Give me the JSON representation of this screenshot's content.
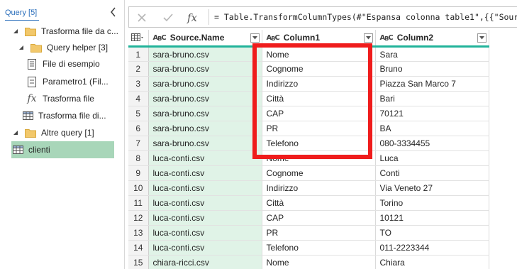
{
  "queries_pane": {
    "title": "Query [5]",
    "items": [
      {
        "label": "Trasforma file da c...",
        "icon": "folder-icon",
        "arrow": "expanded"
      },
      {
        "label": "Query helper [3]",
        "icon": "folder-icon",
        "arrow": "expanded"
      },
      {
        "label": "File di esempio",
        "icon": "document-icon",
        "arrow": ""
      },
      {
        "label": "Parametro1 (Fil...",
        "icon": "parameter-icon",
        "arrow": ""
      },
      {
        "label": "Trasforma file",
        "icon": "function-icon",
        "arrow": ""
      },
      {
        "label": "Trasforma file di...",
        "icon": "table-icon",
        "arrow": ""
      },
      {
        "label": "Altre query [1]",
        "icon": "folder-icon",
        "arrow": "expanded"
      },
      {
        "label": "clienti",
        "icon": "table-icon",
        "arrow": "",
        "selected": true
      }
    ]
  },
  "formula_bar": {
    "fx_label": "fx",
    "formula": "= Table.TransformColumnTypes(#\"Espansa colonna table1\",{{\"Source."
  },
  "grid": {
    "columns": [
      {
        "name": "Source.Name",
        "type": "ABC"
      },
      {
        "name": "Column1",
        "type": "ABC"
      },
      {
        "name": "Column2",
        "type": "ABC"
      }
    ],
    "rows": [
      {
        "n": "1",
        "source": "sara-bruno.csv",
        "c1": "Nome",
        "c2": "Sara"
      },
      {
        "n": "2",
        "source": "sara-bruno.csv",
        "c1": "Cognome",
        "c2": "Bruno"
      },
      {
        "n": "3",
        "source": "sara-bruno.csv",
        "c1": "Indirizzo",
        "c2": "Piazza San Marco 7"
      },
      {
        "n": "4",
        "source": "sara-bruno.csv",
        "c1": "Città",
        "c2": "Bari"
      },
      {
        "n": "5",
        "source": "sara-bruno.csv",
        "c1": "CAP",
        "c2": "70121"
      },
      {
        "n": "6",
        "source": "sara-bruno.csv",
        "c1": "PR",
        "c2": "BA"
      },
      {
        "n": "7",
        "source": "sara-bruno.csv",
        "c1": "Telefono",
        "c2": "080-3334455"
      },
      {
        "n": "8",
        "source": "luca-conti.csv",
        "c1": "Nome",
        "c2": "Luca"
      },
      {
        "n": "9",
        "source": "luca-conti.csv",
        "c1": "Cognome",
        "c2": "Conti"
      },
      {
        "n": "10",
        "source": "luca-conti.csv",
        "c1": "Indirizzo",
        "c2": "Via Veneto 27"
      },
      {
        "n": "11",
        "source": "luca-conti.csv",
        "c1": "Città",
        "c2": "Torino"
      },
      {
        "n": "12",
        "source": "luca-conti.csv",
        "c1": "CAP",
        "c2": "10121"
      },
      {
        "n": "13",
        "source": "luca-conti.csv",
        "c1": "PR",
        "c2": "TO"
      },
      {
        "n": "14",
        "source": "luca-conti.csv",
        "c1": "Telefono",
        "c2": "011-2223344"
      },
      {
        "n": "15",
        "source": "chiara-ricci.csv",
        "c1": "Nome",
        "c2": "Chiara"
      }
    ]
  },
  "colors": {
    "accent_teal": "#21b39a",
    "selection_green": "#a8d6b9",
    "source_column_bg": "#e0f3e7",
    "highlight_red": "#ef1c1c",
    "link_blue": "#2a6ebb"
  }
}
